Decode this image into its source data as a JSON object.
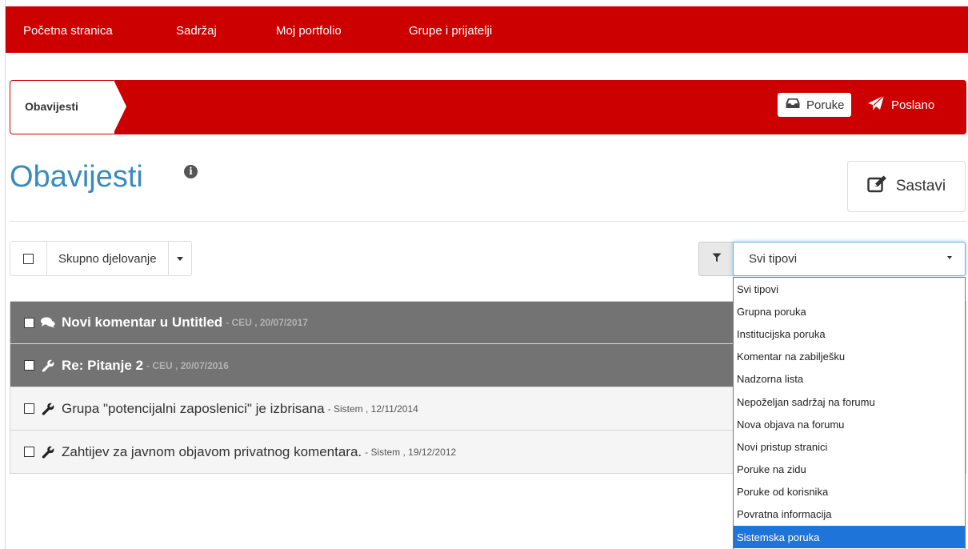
{
  "nav": {
    "items": [
      "Početna stranica",
      "Sadržaj",
      "Moj portfolio",
      "Grupe i prijatelji"
    ]
  },
  "breadcrumb": {
    "current": "Obavijesti",
    "inbox_label": "Poruke",
    "sent_label": "Poslano"
  },
  "page": {
    "title": "Obavijesti",
    "compose_label": "Sastavi"
  },
  "bulk": {
    "label": "Skupno djelovanje"
  },
  "filter": {
    "selected": "Svi tipovi",
    "options": [
      "Svi tipovi",
      "Grupna poruka",
      "Institucijska poruka",
      "Komentar na zabilješku",
      "Nadzorna lista",
      "Nepoželjan sadržaj na forumu",
      "Nova objava na forumu",
      "Novi pristup stranici",
      "Poruke na zidu",
      "Poruke od korisnika",
      "Povratna informacija",
      "Sistemska poruka"
    ],
    "highlighted": "Sistemska poruka"
  },
  "notifications": [
    {
      "subject": "Novi komentar u Untitled",
      "meta": "- CEU , 20/07/2017",
      "icon": "comments-icon",
      "unread": true
    },
    {
      "subject": "Re: Pitanje 2",
      "meta": "- CEU , 20/07/2016",
      "icon": "wrench-icon",
      "unread": true
    },
    {
      "subject": "Grupa \"potencijalni zaposlenici\" je izbrisana",
      "meta": "- Sistem , 12/11/2014",
      "icon": "wrench-icon",
      "unread": false
    },
    {
      "subject": "Zahtijev za javnom objavom privatnog komentara.",
      "meta": "- Sistem , 19/12/2012",
      "icon": "wrench-icon",
      "unread": false
    }
  ],
  "colors": {
    "brand_red": "#cc0000",
    "title_blue": "#3a8bbb",
    "unread_row": "#737373",
    "read_row": "#f5f5f5",
    "option_highlight": "#1e74d8"
  }
}
